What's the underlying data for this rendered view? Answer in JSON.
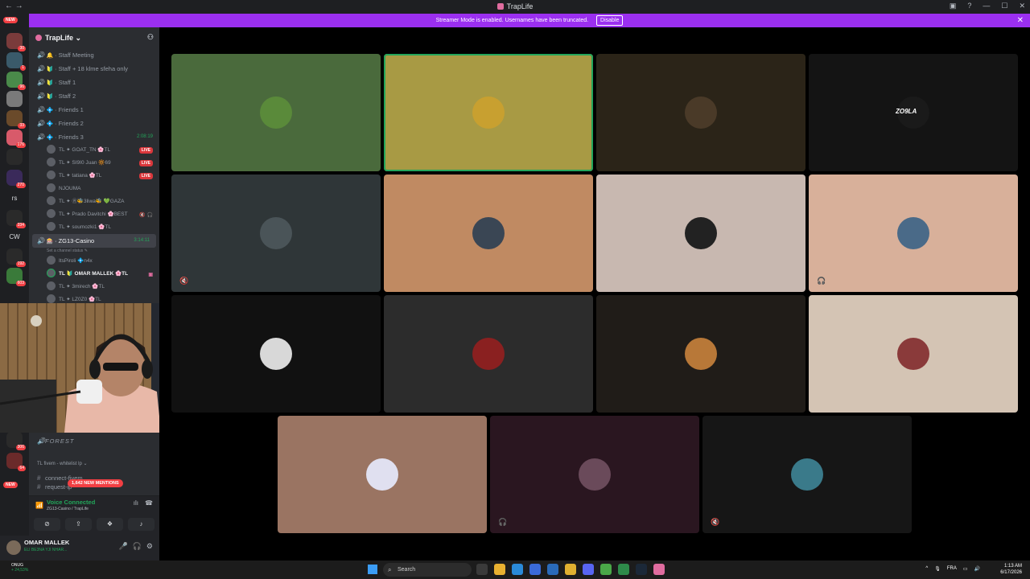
{
  "window": {
    "title": "TrapLife"
  },
  "banner": {
    "text": "Streamer Mode is enabled. Usernames have been truncated.",
    "button": "Disable"
  },
  "rail": {
    "new_top": "NEW",
    "badges": [
      "30",
      "1",
      "96",
      "33",
      "176",
      "270",
      "334",
      "192",
      "603",
      "306",
      "64"
    ],
    "labels": [
      "rs",
      "CW"
    ],
    "new_bottom": "NEW"
  },
  "server": {
    "name": "TrapLife ⌄"
  },
  "channels": [
    {
      "name": "Staff Meeting",
      "emoji": "🔔"
    },
    {
      "name": "Staff + 18 klme sfeha only",
      "emoji": "🔰"
    },
    {
      "name": "Staff 1",
      "emoji": "🔰"
    },
    {
      "name": "Staff 2",
      "emoji": "🔰"
    },
    {
      "name": "Friends 1",
      "emoji": "💠"
    },
    {
      "name": "Friends 2",
      "emoji": "💠"
    },
    {
      "name": "Friends 3",
      "emoji": "💠",
      "timer": "2:08:19"
    }
  ],
  "friends3_users": [
    {
      "name": "TL ✦ GOAT_TN 🌸TL",
      "live": "LIVE"
    },
    {
      "name": "TL ✦ SI9I0 Juan 🔆69",
      "live": "LIVE"
    },
    {
      "name": "TL ✦ tatiana 🌸TL",
      "live": "LIVE"
    },
    {
      "name": "NJOUMA"
    },
    {
      "name": "TL ✦ Ⓡ🐝3liwa🐝 💚GAZA"
    },
    {
      "name": "TL ✦ Prado Davitchi 🌸BEST"
    },
    {
      "name": "TL ✦ soumozki1 🌸TL"
    }
  ],
  "active_channel": {
    "name": "ZG13-Casino",
    "timer": "3:14:11",
    "status": "Set a channel status ✎"
  },
  "casino_users": [
    {
      "name": "ItsPiroli 💠n4x"
    },
    {
      "name": "TL 🔰 OMAR MALLEK 🌸TL"
    },
    {
      "name": "TL ✦ 3mirech 🌸TL"
    },
    {
      "name": "TL ✦ LZ0Z0 🌸TL"
    }
  ],
  "lower_channels": [
    {
      "name": "FOREST"
    },
    {
      "name": "TL fivem - whitelist lp ⌄"
    },
    {
      "name": "connect-fivem"
    },
    {
      "name": "request-ip"
    }
  ],
  "mentions": "1,642 NEW MENTIONS",
  "voice": {
    "title": "Voice Connected",
    "subtitle": "ZG13-Casino / TrapLife"
  },
  "user": {
    "name": "OMAR MALLEK",
    "status": "ELI BE3NA YJI NHAR..."
  },
  "tiles": [
    {
      "bg": "#4a6a3c",
      "avatar": "#5a8a3a"
    },
    {
      "bg": "#a89a44",
      "avatar": "#c8a030",
      "speaking": true
    },
    {
      "bg": "#2b2418",
      "avatar": "#4a3a28"
    },
    {
      "bg": "#141414",
      "avatar": "#1a1a1a",
      "label": "ZO9LA"
    },
    {
      "bg": "#2f3638",
      "avatar": "#4a5458",
      "icon": "🔇"
    },
    {
      "bg": "#c08a62",
      "avatar": "#3a4654"
    },
    {
      "bg": "#c8b8b0",
      "avatar": "#222222"
    },
    {
      "bg": "#d8b09a",
      "avatar": "#4a6a88",
      "icon": "🎧"
    },
    {
      "bg": "#111111",
      "avatar": "#d8d8d8"
    },
    {
      "bg": "#2c2c2c",
      "avatar": "#8a2020"
    },
    {
      "bg": "#201c18",
      "avatar": "#b87838"
    },
    {
      "bg": "#d4c4b4",
      "avatar": "#8a3a3a"
    },
    {
      "bg": "#9a7462",
      "avatar": "#e0e0f0"
    },
    {
      "bg": "#2a1620",
      "avatar": "#6a4a5a",
      "icon": "🎧"
    },
    {
      "bg": "#161616",
      "avatar": "#3a7a8a",
      "icon": "🔇"
    }
  ],
  "taskbar": {
    "temp": "ONUG",
    "change": "+ 24,53%",
    "search": "Search",
    "lang": "FRA",
    "time": "1:13 AM",
    "date": "6/17/2026"
  }
}
